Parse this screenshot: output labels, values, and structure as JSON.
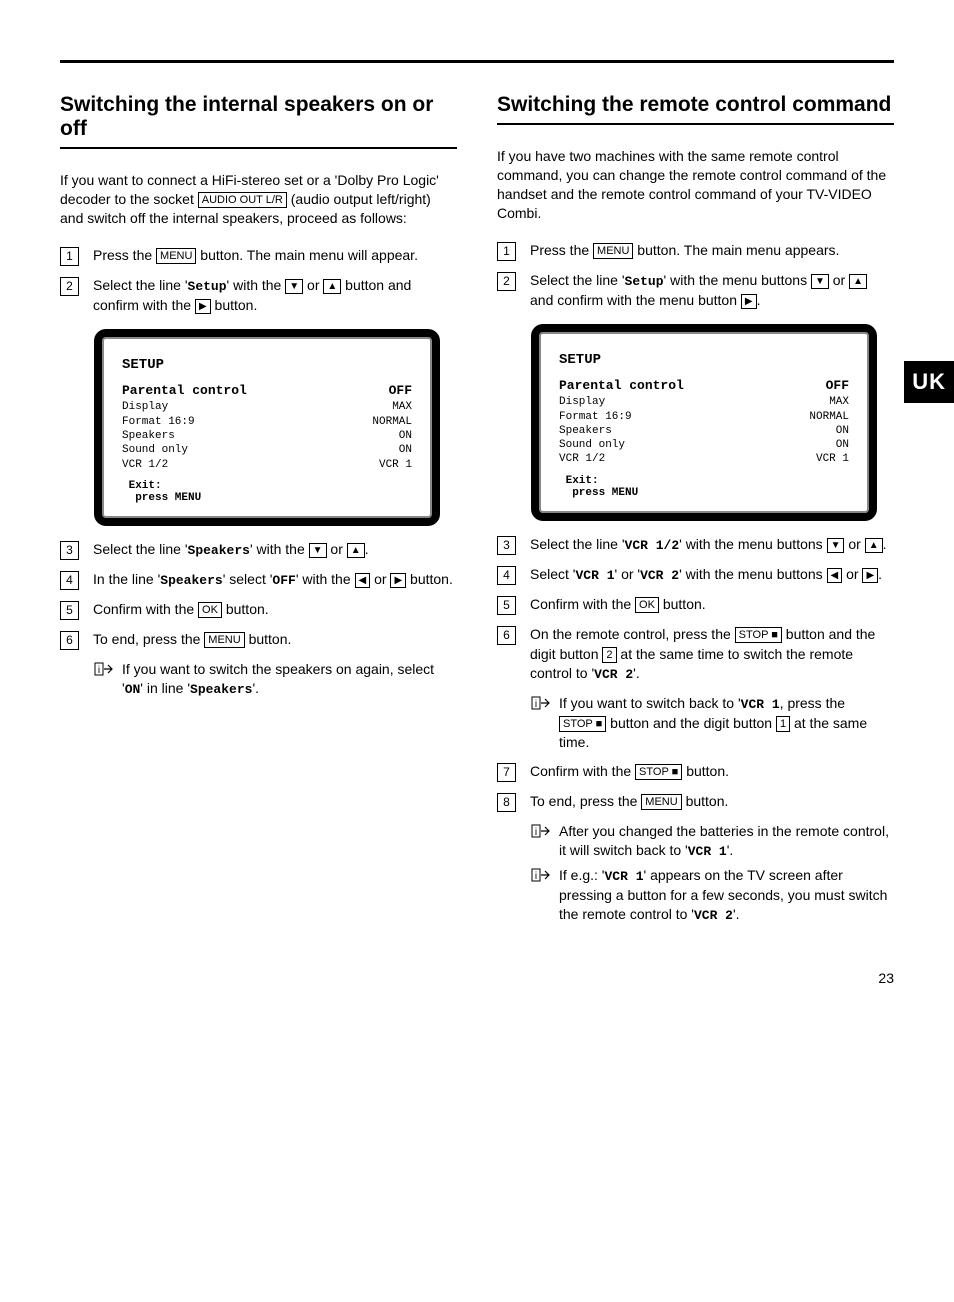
{
  "page_number": "23",
  "side_tab": "UK",
  "left": {
    "heading": "Switching the internal speakers on or off",
    "intro_1": "If you want to connect a HiFi-stereo set or a 'Dolby Pro Logic' decoder to the socket ",
    "intro_key": "AUDIO OUT L/R",
    "intro_2": " (audio output left/right) and switch off the internal speakers, proceed as follows:",
    "steps": {
      "s1a": "Press the ",
      "s1_key": "MENU",
      "s1b": " button. The main menu will appear.",
      "s2a": "Select the line '",
      "s2_mono": "Setup",
      "s2b": "' with the ",
      "s2c": " or ",
      "s2d": " button and confirm with the ",
      "s2e": " button.",
      "s3a": "Select the line '",
      "s3_mono": "Speakers",
      "s3b": "' with the ",
      "s3c": " or ",
      "s3d": ".",
      "s4a": "In the line '",
      "s4_mono1": "Speakers",
      "s4b": "' select '",
      "s4_mono2": "OFF",
      "s4c": "' with the ",
      "s4d": " or ",
      "s4e": " button.",
      "s5a": "Confirm with the ",
      "s5_key": "OK",
      "s5b": " button.",
      "s6a": "To end, press the ",
      "s6_key": "MENU",
      "s6b": " button.",
      "tip_a": "If you want to switch the speakers on again, select '",
      "tip_mono1": "ON",
      "tip_b": "' in line '",
      "tip_mono2": "Speakers",
      "tip_c": "'."
    }
  },
  "right": {
    "heading": "Switching the remote control command",
    "intro": "If you have two machines with the same remote control command, you can change the remote control command of the handset and the remote control command of your TV-VIDEO Combi.",
    "steps": {
      "s1a": "Press the ",
      "s1_key": "MENU",
      "s1b": " button. The main menu appears.",
      "s2a": "Select the line '",
      "s2_mono": "Setup",
      "s2b": "' with the menu buttons ",
      "s2c": " or ",
      "s2d": " and confirm with the menu button ",
      "s2e": ".",
      "s3a": "Select the line '",
      "s3_mono": "VCR 1/2",
      "s3b": "' with the menu buttons ",
      "s3c": " or ",
      "s3d": ".",
      "s4a": "Select '",
      "s4_mono1": "VCR 1",
      "s4b": "' or '",
      "s4_mono2": "VCR 2",
      "s4c": "' with the menu buttons ",
      "s4d": " or ",
      "s4e": ".",
      "s5a": "Confirm with the ",
      "s5_key": "OK",
      "s5b": " button.",
      "s6a": "On the remote control, press the ",
      "s6_key": "STOP ■",
      "s6b": " button and the digit button ",
      "s6_digit": "2",
      "s6c": " at the same time to switch the remote control to '",
      "s6_mono": "VCR 2",
      "s6d": "'.",
      "tip6a": "If you want to switch back to '",
      "tip6_mono": "VCR 1",
      "tip6b": ", press the ",
      "tip6_key": "STOP ■",
      "tip6c": " button and the digit button ",
      "tip6_digit": "1",
      "tip6d": " at the same time.",
      "s7a": "Confirm with the ",
      "s7_key": "STOP ■",
      "s7b": " button.",
      "s8a": "To end, press the ",
      "s8_key": "MENU",
      "s8b": " button.",
      "tip8a": "After you changed the batteries in the remote control, it will switch back to '",
      "tip8a_mono": "VCR 1",
      "tip8a_end": "'.",
      "tip8b": "If e.g.: '",
      "tip8b_mono1": "VCR 1",
      "tip8b_mid": "' appears on the TV screen after pressing a button for a few seconds, you must switch the remote control to '",
      "tip8b_mono2": "VCR 2",
      "tip8b_end": "'."
    }
  },
  "screen": {
    "title": "SETUP",
    "rows": [
      {
        "label": "Parental control",
        "value": "OFF",
        "big": true
      },
      {
        "label": "Display",
        "value": "MAX"
      },
      {
        "label": "Format 16:9",
        "value": "NORMAL"
      },
      {
        "label": "Speakers",
        "value": "ON"
      },
      {
        "label": "Sound only",
        "value": "ON"
      },
      {
        "label": "VCR 1/2",
        "value": "VCR 1"
      }
    ],
    "footer1": "Exit:",
    "footer2": "press MENU"
  }
}
